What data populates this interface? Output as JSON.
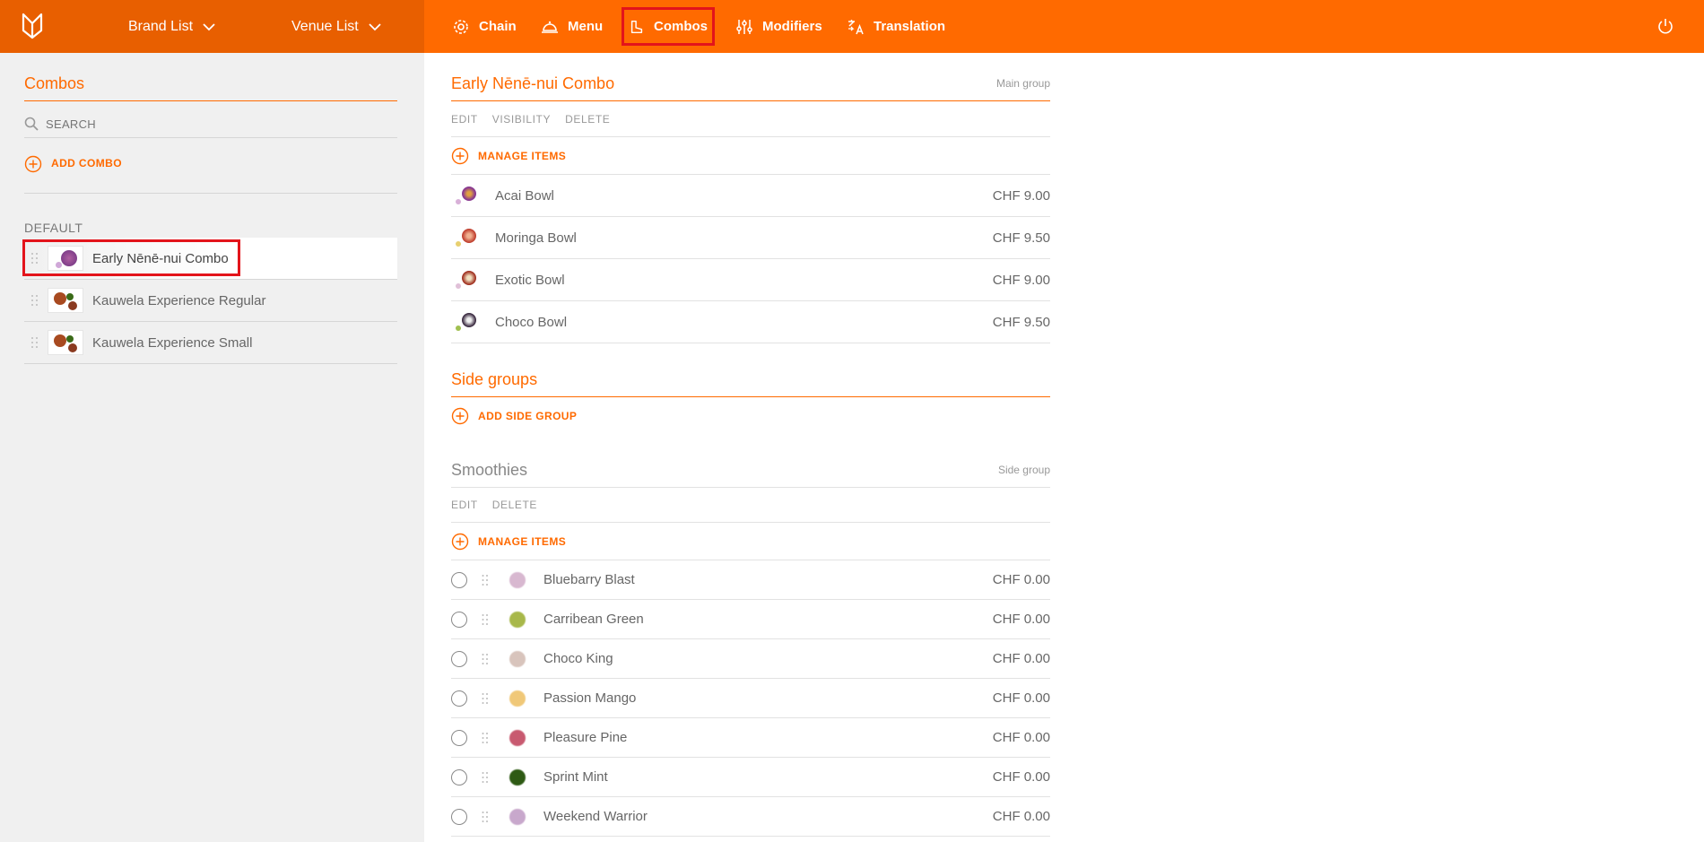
{
  "header": {
    "brand_list": "Brand List",
    "venue_list": "Venue List",
    "nav": [
      {
        "label": "Chain",
        "icon": "gear-icon"
      },
      {
        "label": "Menu",
        "icon": "cloche-icon"
      },
      {
        "label": "Combos",
        "icon": "boot-icon"
      },
      {
        "label": "Modifiers",
        "icon": "sliders-icon"
      },
      {
        "label": "Translation",
        "icon": "translate-icon"
      }
    ],
    "active_nav": "Combos"
  },
  "sidebar": {
    "title": "Combos",
    "search_placeholder": "SEARCH",
    "add_label": "ADD COMBO",
    "section_label": "DEFAULT",
    "items": [
      {
        "label": "Early Nēnē-nui Combo",
        "selected": true
      },
      {
        "label": "Kauwela Experience Regular",
        "selected": false
      },
      {
        "label": "Kauwela Experience Small",
        "selected": false
      }
    ]
  },
  "main": {
    "combo_title": "Early Nēnē-nui Combo",
    "combo_group": "Main group",
    "actions": [
      "EDIT",
      "VISIBILITY",
      "DELETE"
    ],
    "manage_label": "MANAGE ITEMS",
    "items": [
      {
        "name": "Acai Bowl",
        "price": "CHF 9.00"
      },
      {
        "name": "Moringa Bowl",
        "price": "CHF 9.50"
      },
      {
        "name": "Exotic Bowl",
        "price": "CHF 9.00"
      },
      {
        "name": "Choco Bowl",
        "price": "CHF 9.50"
      }
    ],
    "side_groups_title": "Side groups",
    "add_side_group": "ADD SIDE GROUP",
    "smoothies": {
      "title": "Smoothies",
      "group": "Side group",
      "actions": [
        "EDIT",
        "DELETE"
      ],
      "manage_label": "MANAGE ITEMS",
      "items": [
        {
          "name": "Bluebarry Blast",
          "price": "CHF 0.00",
          "color": "#d8b8d0"
        },
        {
          "name": "Carribean Green",
          "price": "CHF 0.00",
          "color": "#a8b84a"
        },
        {
          "name": "Choco King",
          "price": "CHF 0.00",
          "color": "#d8c4bc"
        },
        {
          "name": "Passion Mango",
          "price": "CHF 0.00",
          "color": "#f0c878"
        },
        {
          "name": "Pleasure Pine",
          "price": "CHF 0.00",
          "color": "#c85a70"
        },
        {
          "name": "Sprint Mint",
          "price": "CHF 0.00",
          "color": "#2e5a14"
        },
        {
          "name": "Weekend Warrior",
          "price": "CHF 0.00",
          "color": "#c8a8cc"
        }
      ]
    }
  },
  "colors": {
    "accent": "#ff6a00",
    "highlight": "#e3141b"
  }
}
